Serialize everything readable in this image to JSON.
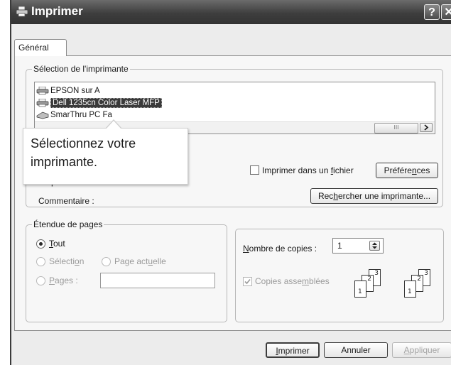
{
  "window": {
    "title": "Imprimer",
    "help_label": "?",
    "close_label": "✕"
  },
  "tabs": [
    {
      "label": "Général",
      "active": true
    }
  ],
  "printer_selection": {
    "legend": "Sélection de l'imprimante",
    "printers": [
      {
        "name": "EPSON sur A",
        "icon": "printer-icon",
        "selected": false
      },
      {
        "name": "Dell 1235cn Color Laser MFP",
        "icon": "printer-icon",
        "selected": true
      },
      {
        "name": "SmarThru PC Fa",
        "icon": "fax-icon",
        "selected": false
      }
    ],
    "scroll_thumb": "III",
    "location_label": "Emplacement :",
    "comment_label": "Commentaire :",
    "print_to_file": {
      "pre": "Imprimer dans un ",
      "u": "f",
      "post": "ichier",
      "checked": false
    },
    "preferences": {
      "pre": "Préfére",
      "u": "n",
      "post": "ces"
    },
    "find_printer": {
      "pre": "Rec",
      "u": "h",
      "post": "ercher une imprimante..."
    }
  },
  "tooltip": {
    "text": "Sélectionnez votre\nimprimante."
  },
  "page_range": {
    "legend": "Étendue de pages",
    "all": {
      "u": "T",
      "post": "out",
      "selected": true
    },
    "selection": {
      "pre": "Sélecti",
      "u": "o",
      "post": "n",
      "enabled": false
    },
    "current_page": {
      "pre": "Page act",
      "u": "u",
      "post": "elle",
      "enabled": false
    },
    "pages": {
      "u": "P",
      "post": "ages :",
      "enabled": false,
      "value": ""
    }
  },
  "copies": {
    "copies_label": {
      "u": "N",
      "post": "ombre de copies :"
    },
    "count": "1",
    "collate": {
      "pre": "Copies asse",
      "u": "m",
      "post": "blées",
      "checked": true,
      "enabled": false
    },
    "icon_numbers": [
      "1",
      "2",
      "3"
    ]
  },
  "footer": {
    "print": {
      "u": "I",
      "post": "mprimer"
    },
    "cancel": "Annuler",
    "apply": {
      "u": "A",
      "post": "ppliquer",
      "enabled": false
    }
  }
}
